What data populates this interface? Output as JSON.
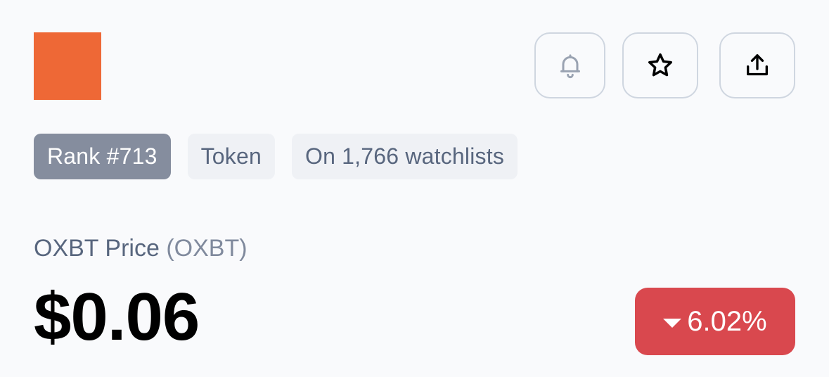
{
  "coin": {
    "logo_color": "#ee6836",
    "rank": "Rank #713",
    "type": "Token",
    "watchlists": "On 1,766 watchlists",
    "price_label": "OXBT Price",
    "symbol": "(OXBT)",
    "price": "$0.06",
    "change_pct": "6.02%",
    "change_direction": "down"
  },
  "actions": [
    {
      "name": "alert",
      "icon": "bell-icon"
    },
    {
      "name": "watchlist",
      "icon": "star-icon"
    },
    {
      "name": "share",
      "icon": "share-icon"
    }
  ],
  "colors": {
    "background": "#f9fafc",
    "negative": "#d9484e",
    "rank_chip": "#858d9e",
    "chip": "#eff1f5",
    "muted_text": "#58667e"
  }
}
